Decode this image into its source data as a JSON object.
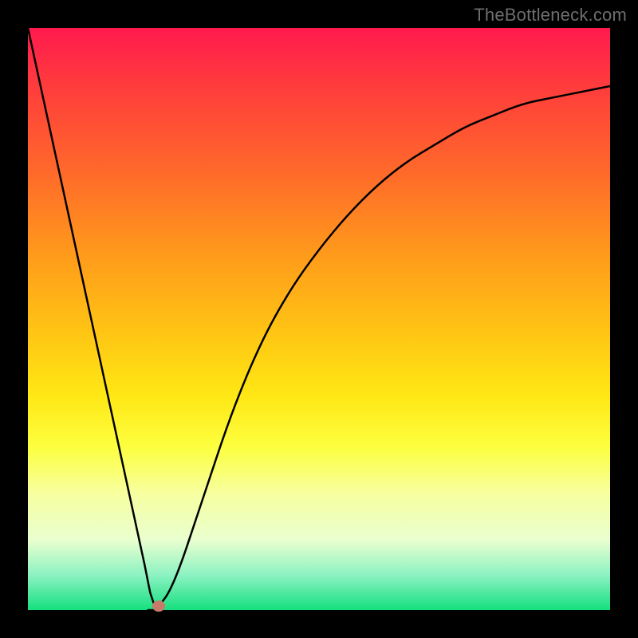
{
  "watermark": "TheBottleneck.com",
  "chart_data": {
    "type": "line",
    "title": "",
    "xlabel": "",
    "ylabel": "",
    "xlim": [
      0,
      100
    ],
    "ylim": [
      0,
      100
    ],
    "grid": false,
    "series": [
      {
        "name": "bottleneck-curve",
        "x": [
          0,
          5,
          10,
          15,
          20,
          21,
          22,
          25,
          30,
          35,
          40,
          45,
          50,
          55,
          60,
          65,
          70,
          75,
          80,
          85,
          90,
          95,
          100
        ],
        "values": [
          100,
          77,
          54,
          31,
          8,
          3,
          0,
          4,
          19,
          34,
          46,
          55,
          62,
          68,
          73,
          77,
          80,
          83,
          85,
          87,
          88,
          89,
          90
        ]
      }
    ],
    "marker": {
      "x": 22.5,
      "y": 0.7,
      "color": "#c87a6a"
    },
    "background_gradient": {
      "top": "#ff1a4e",
      "bottom": "#14e07e"
    }
  }
}
